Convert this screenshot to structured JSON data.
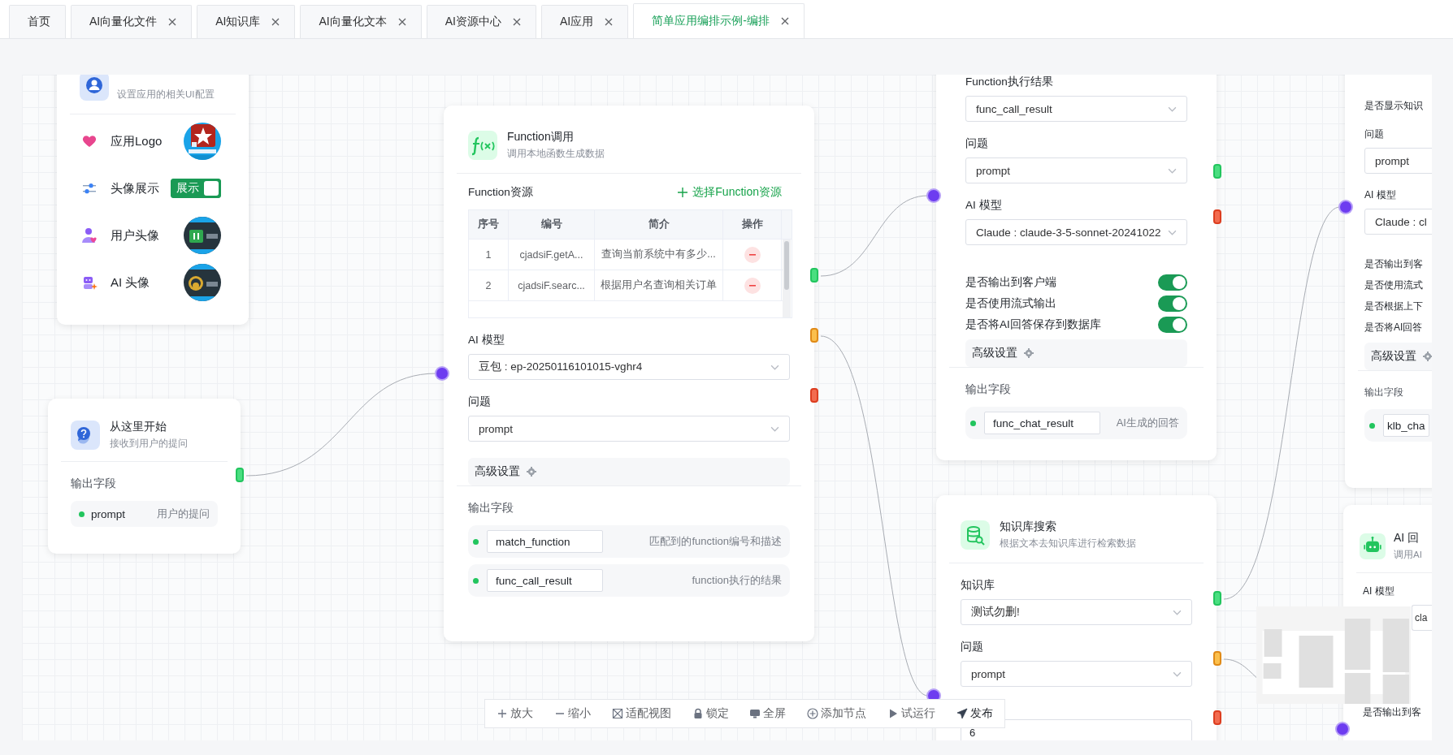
{
  "tabs": [
    {
      "label": "首页",
      "closable": false,
      "selected": false
    },
    {
      "label": "AI向量化文件",
      "closable": true,
      "selected": false
    },
    {
      "label": "AI知识库",
      "closable": true,
      "selected": false
    },
    {
      "label": "AI向量化文本",
      "closable": true,
      "selected": false
    },
    {
      "label": "AI资源中心",
      "closable": true,
      "selected": false
    },
    {
      "label": "AI应用",
      "closable": true,
      "selected": false
    },
    {
      "label": "简单应用编排示例-编排",
      "closable": true,
      "selected": true
    }
  ],
  "ui_settings_node": {
    "subtitle": "设置应用的相关UI配置",
    "rows": [
      {
        "label": "应用Logo"
      },
      {
        "kind": "switch",
        "label": "头像展示",
        "switch_text": "展示",
        "on": true
      },
      {
        "label": "用户头像"
      },
      {
        "label": "AI  头像"
      }
    ]
  },
  "start_node": {
    "title": "从这里开始",
    "subtitle": "接收到用户的提问",
    "output_label": "输出字段",
    "outputs": [
      {
        "name": "prompt",
        "description": "用户的提问"
      }
    ]
  },
  "function_node": {
    "title": "Function调用",
    "subtitle": "调用本地函数生成数据",
    "resource_label": "Function资源",
    "add_link": "选择Function资源",
    "table": {
      "columns": [
        "序号",
        "编号",
        "简介",
        "操作"
      ],
      "rows": [
        {
          "cells": [
            "1",
            "cjadsiF.getA...",
            "查询当前系统中有多少..."
          ]
        },
        {
          "cells": [
            "2",
            "cjadsiF.searc...",
            "根据用户名查询相关订单"
          ]
        }
      ]
    },
    "fields": [
      {
        "label": "AI 模型",
        "value": "豆包 : ep-20250116101015-vghr4"
      },
      {
        "label": "问题",
        "value": "prompt"
      }
    ],
    "advanced": "高级设置",
    "output_label": "输出字段",
    "outputs": [
      {
        "name": "match_function",
        "description": "匹配到的function编号和描述"
      },
      {
        "name": "func_call_result",
        "description": "function执行的结果"
      }
    ]
  },
  "chat_node": {
    "fields": [
      {
        "label": "Function执行结果",
        "value": "func_call_result"
      },
      {
        "label": "问题",
        "value": "prompt"
      },
      {
        "label": "AI 模型",
        "value": "Claude : claude-3-5-sonnet-20241022"
      }
    ],
    "switches": [
      {
        "label": "是否输出到客户端",
        "on": true
      },
      {
        "label": "是否使用流式输出",
        "on": true
      },
      {
        "label": "是否将AI回答保存到数据库",
        "on": true
      }
    ],
    "advanced": "高级设置",
    "output_label": "输出字段",
    "outputs": [
      {
        "name": "func_chat_result",
        "description": "AI生成的回答"
      }
    ]
  },
  "knowledge_node": {
    "title": "知识库搜索",
    "subtitle": "根据文本去知识库进行检索数据",
    "fields": [
      {
        "label": "知识库",
        "value": "测试勿删!"
      },
      {
        "label": "问题",
        "value": "prompt"
      }
    ],
    "count_value": "6"
  },
  "right_node": {
    "top_label": "是否显示知识",
    "fields": [
      {
        "label": "问题",
        "value": "prompt"
      },
      {
        "label": "AI 模型",
        "value": "Claude : cl"
      }
    ],
    "options": [
      "是否输出到客",
      "是否使用流式",
      "是否根据上下",
      "是否将AI回答"
    ],
    "advanced": "高级设置",
    "output_label": "输出字段",
    "outputs": [
      {
        "name": "klb_cha"
      }
    ]
  },
  "answer_node": {
    "title": "AI 回",
    "subtitle": "调用AI",
    "fields": [
      {
        "label": "AI 模型",
        "value": "cla"
      }
    ],
    "options": [
      "是否输出到客"
    ]
  },
  "toolbar": [
    {
      "label": "放大"
    },
    {
      "label": "缩小"
    },
    {
      "label": "适配视图"
    },
    {
      "label": "锁定"
    },
    {
      "label": "全屏"
    },
    {
      "label": "添加节点"
    },
    {
      "label": "试运行"
    },
    {
      "label": "发布"
    }
  ]
}
